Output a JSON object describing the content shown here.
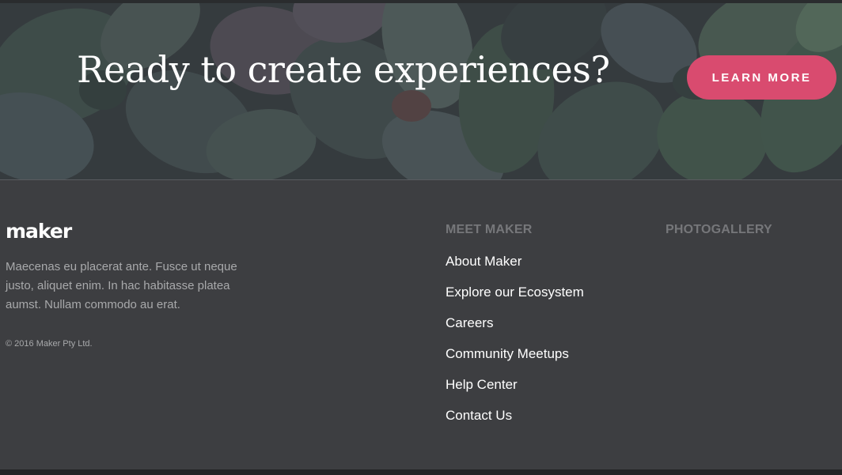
{
  "hero": {
    "title": "Ready to create experiences?",
    "button_label": "LEARN MORE"
  },
  "footer": {
    "brand": "maker",
    "description": "Maecenas eu placerat ante. Fusce ut neque justo, aliquet enim. In hac habitasse platea aumst. Nullam commodo au erat.",
    "copyright": "© 2016 Maker Pty Ltd.",
    "meet": {
      "heading": "MEET MAKER",
      "links": [
        {
          "label": "About Maker"
        },
        {
          "label": "Explore our Ecosystem"
        },
        {
          "label": "Careers"
        },
        {
          "label": "Community Meetups"
        },
        {
          "label": "Help Center"
        },
        {
          "label": "Contact Us"
        }
      ]
    },
    "photogallery": {
      "heading": "PHOTOGALLERY"
    }
  },
  "colors": {
    "accent": "#d94b6f",
    "footer_bg": "#3d3e41",
    "heading_muted": "#76777a",
    "body_text": "#a8a9ab"
  }
}
